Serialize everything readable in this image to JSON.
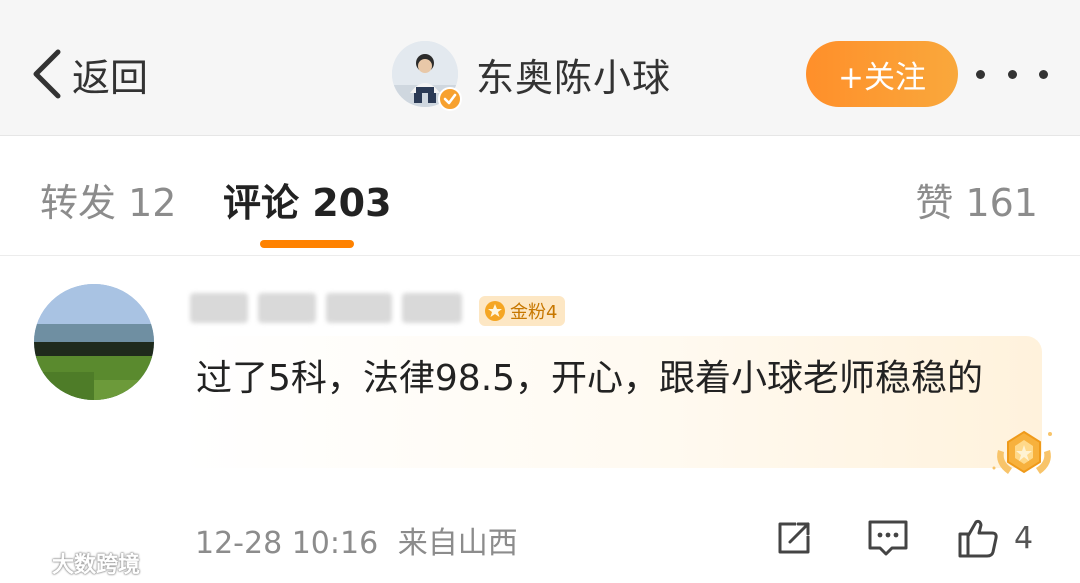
{
  "nav": {
    "back_label": "返回",
    "author_name": "东奥陈小球",
    "follow_label": "+关注"
  },
  "tabs": {
    "repost": "转发 12",
    "comment": "评论 203",
    "like": "赞 161"
  },
  "comment": {
    "badge_label": "金粉4",
    "text": "过了5科，法律98.5，开心，跟着小球老师稳稳的",
    "timestamp": "12-28 10:16",
    "source": "来自山西",
    "like_count": "4"
  },
  "watermark": {
    "text": "大数跨境"
  },
  "colors": {
    "accent": "#ff8200",
    "follow_gradient_start": "#ff8f2a",
    "follow_gradient_end": "#f9a83c",
    "muted_text": "#8c8c8c",
    "badge_bg": "#fde7c4"
  },
  "icons": [
    "chevron-left-icon",
    "verified-icon",
    "more-icon",
    "fan-badge-icon",
    "medal-icon",
    "share-icon",
    "comment-icon",
    "thumbs-up-icon"
  ]
}
